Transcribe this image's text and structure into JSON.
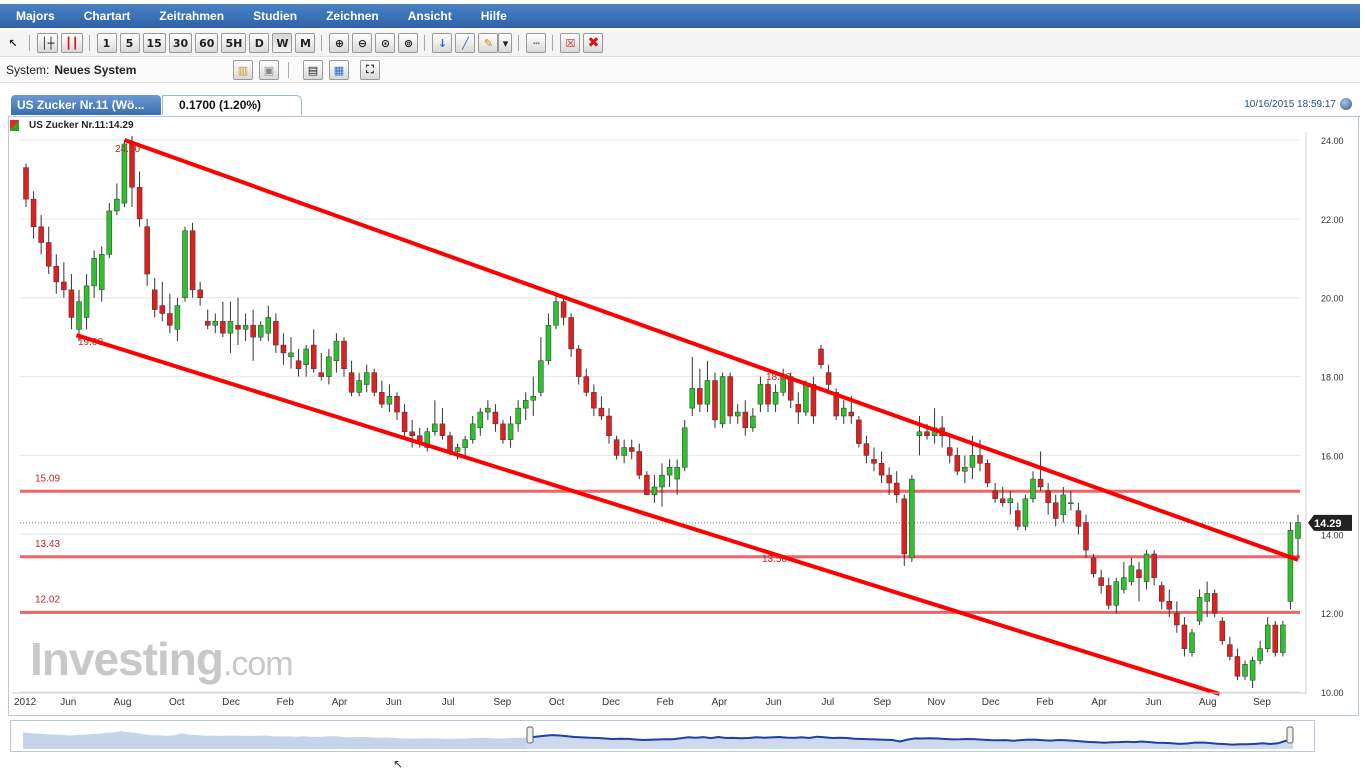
{
  "menu": [
    "Majors",
    "Chartart",
    "Zeitrahmen",
    "Studien",
    "Zeichnen",
    "Ansicht",
    "Hilfe"
  ],
  "toolbar": {
    "timeframes": [
      "1",
      "5",
      "15",
      "30",
      "60",
      "5H",
      "D",
      "W",
      "M"
    ],
    "active_timeframe": "W"
  },
  "system": {
    "label": "System:",
    "value": "Neues System"
  },
  "instrument": {
    "tab_title": "US Zucker Nr.11 (Wö...",
    "change": "0.1700 (1.20%)",
    "timestamp": "10/16/2015 18:59:17",
    "legend": "US Zucker Nr.11:14.29",
    "last_price_label": "14.29"
  },
  "watermark": {
    "brand": "Investing",
    "suffix": ".com"
  },
  "colors": {
    "up": "#2ec02e",
    "down": "#e02020",
    "line": "#ff0000",
    "accent": "#3a6eb0"
  },
  "chart_data": {
    "type": "candlestick",
    "title": "US Zucker Nr.11",
    "ylim": [
      10,
      24
    ],
    "y_ticks": [
      "24.00",
      "22.00",
      "20.00",
      "18.00",
      "16.00",
      "14.00",
      "12.00",
      "10.00"
    ],
    "x_ticks": [
      "2012",
      "Jun",
      "Aug",
      "Oct",
      "Dec",
      "Feb",
      "Apr",
      "Jun",
      "Jul",
      "Sep",
      "Oct",
      "Dec",
      "Feb",
      "Apr",
      "Jun",
      "Jul",
      "Sep",
      "Nov",
      "Dec",
      "Feb",
      "Apr",
      "Jun",
      "Aug",
      "Sep"
    ],
    "last_price": 14.29,
    "horizontal_levels": [
      {
        "value": 15.09,
        "label": "15.09"
      },
      {
        "value": 13.43,
        "label": "13.43"
      },
      {
        "value": 12.02,
        "label": "12.02"
      }
    ],
    "trend_lines": [
      {
        "name": "upper channel",
        "from": [
          0.0818,
          24.0
        ],
        "to": [
          1.0,
          13.35
        ]
      },
      {
        "name": "lower channel",
        "from": [
          0.0442,
          19.05
        ],
        "to": [
          0.9386,
          9.95
        ]
      }
    ],
    "channel_labels": [
      "24.00",
      "19.00",
      "18.00",
      "13.50"
    ],
    "candles": [
      [
        23.3,
        23.4,
        22.3,
        22.5
      ],
      [
        22.5,
        22.7,
        21.5,
        21.8
      ],
      [
        21.8,
        22.1,
        21.1,
        21.4
      ],
      [
        21.4,
        21.8,
        20.6,
        20.8
      ],
      [
        20.8,
        21.1,
        20.1,
        20.4
      ],
      [
        20.4,
        20.9,
        20.0,
        20.2
      ],
      [
        20.2,
        20.6,
        19.2,
        19.5
      ],
      [
        19.2,
        20.2,
        18.9,
        19.9
      ],
      [
        19.5,
        20.6,
        19.2,
        20.3
      ],
      [
        20.3,
        21.2,
        20.0,
        21.0
      ],
      [
        20.2,
        21.3,
        19.9,
        21.1
      ],
      [
        21.1,
        22.4,
        21.0,
        22.2
      ],
      [
        22.2,
        22.9,
        22.1,
        22.5
      ],
      [
        22.4,
        24.0,
        22.3,
        23.9
      ],
      [
        23.9,
        24.1,
        22.3,
        22.8
      ],
      [
        22.8,
        23.2,
        21.8,
        22.0
      ],
      [
        21.8,
        22.0,
        20.3,
        20.6
      ],
      [
        20.2,
        20.5,
        19.5,
        19.7
      ],
      [
        19.8,
        20.4,
        19.4,
        19.6
      ],
      [
        19.6,
        20.1,
        19.1,
        19.3
      ],
      [
        19.2,
        20.0,
        18.9,
        19.8
      ],
      [
        20.0,
        21.8,
        19.9,
        21.7
      ],
      [
        21.7,
        21.9,
        20.0,
        20.2
      ],
      [
        20.2,
        20.4,
        19.8,
        20.0
      ],
      [
        19.4,
        19.7,
        19.2,
        19.3
      ],
      [
        19.3,
        19.6,
        19.1,
        19.4
      ],
      [
        19.4,
        19.9,
        19.0,
        19.1
      ],
      [
        19.1,
        19.9,
        18.6,
        19.4
      ],
      [
        19.3,
        20.0,
        18.8,
        19.2
      ],
      [
        19.2,
        19.6,
        18.9,
        19.3
      ],
      [
        19.3,
        19.7,
        18.4,
        19.0
      ],
      [
        19.0,
        19.4,
        18.9,
        19.3
      ],
      [
        19.1,
        19.8,
        18.9,
        19.5
      ],
      [
        19.4,
        19.6,
        18.6,
        18.8
      ],
      [
        18.8,
        19.1,
        18.3,
        18.6
      ],
      [
        18.5,
        19.0,
        18.2,
        18.6
      ],
      [
        18.4,
        18.7,
        18.0,
        18.2
      ],
      [
        18.3,
        18.8,
        18.0,
        18.7
      ],
      [
        18.8,
        19.2,
        18.1,
        18.2
      ],
      [
        18.1,
        18.6,
        17.9,
        18.0
      ],
      [
        18.0,
        18.7,
        17.8,
        18.5
      ],
      [
        18.4,
        19.1,
        18.1,
        18.9
      ],
      [
        18.9,
        19.0,
        18.0,
        18.2
      ],
      [
        18.1,
        18.4,
        17.5,
        17.6
      ],
      [
        17.6,
        18.1,
        17.5,
        17.9
      ],
      [
        17.8,
        18.3,
        17.6,
        18.1
      ],
      [
        18.1,
        18.2,
        17.5,
        17.6
      ],
      [
        17.6,
        17.9,
        17.2,
        17.3
      ],
      [
        17.3,
        17.8,
        17.1,
        17.5
      ],
      [
        17.5,
        17.6,
        16.9,
        17.1
      ],
      [
        17.1,
        17.3,
        16.4,
        16.6
      ],
      [
        16.6,
        16.9,
        16.2,
        16.5
      ],
      [
        16.5,
        16.7,
        16.2,
        16.3
      ],
      [
        16.2,
        16.7,
        16.1,
        16.6
      ],
      [
        16.6,
        17.4,
        16.5,
        16.8
      ],
      [
        16.8,
        17.2,
        16.4,
        16.5
      ],
      [
        16.5,
        16.6,
        16.0,
        16.1
      ],
      [
        16.1,
        16.3,
        15.9,
        16.2
      ],
      [
        16.2,
        16.5,
        16.0,
        16.4
      ],
      [
        16.4,
        17.0,
        16.3,
        16.8
      ],
      [
        16.7,
        17.2,
        16.5,
        17.1
      ],
      [
        17.1,
        17.4,
        16.9,
        17.2
      ],
      [
        17.1,
        17.3,
        16.6,
        16.8
      ],
      [
        16.8,
        16.9,
        16.3,
        16.4
      ],
      [
        16.4,
        17.0,
        16.2,
        16.8
      ],
      [
        16.8,
        17.4,
        16.6,
        17.2
      ],
      [
        17.2,
        17.6,
        16.9,
        17.4
      ],
      [
        17.4,
        18.0,
        17.0,
        17.5
      ],
      [
        17.6,
        19.0,
        17.5,
        18.4
      ],
      [
        18.4,
        19.6,
        18.3,
        19.3
      ],
      [
        19.3,
        20.1,
        19.2,
        19.9
      ],
      [
        19.9,
        20.0,
        19.3,
        19.5
      ],
      [
        19.5,
        19.6,
        18.5,
        18.7
      ],
      [
        18.7,
        18.8,
        17.8,
        18.0
      ],
      [
        18.0,
        18.2,
        17.5,
        17.6
      ],
      [
        17.6,
        17.8,
        17.0,
        17.2
      ],
      [
        17.2,
        17.5,
        16.9,
        17.0
      ],
      [
        17.0,
        17.2,
        16.3,
        16.5
      ],
      [
        16.4,
        16.5,
        15.9,
        16.0
      ],
      [
        16.0,
        16.4,
        15.8,
        16.2
      ],
      [
        16.2,
        16.4,
        15.9,
        16.1
      ],
      [
        16.1,
        16.3,
        15.4,
        15.5
      ],
      [
        15.5,
        15.6,
        15.0,
        15.0
      ],
      [
        15.0,
        15.5,
        14.8,
        15.2
      ],
      [
        15.2,
        15.8,
        14.7,
        15.5
      ],
      [
        15.5,
        15.9,
        15.2,
        15.7
      ],
      [
        15.4,
        15.9,
        15.0,
        15.7
      ],
      [
        15.7,
        16.9,
        15.6,
        16.7
      ],
      [
        17.2,
        18.5,
        17.0,
        17.7
      ],
      [
        17.7,
        18.2,
        17.1,
        17.3
      ],
      [
        17.3,
        18.4,
        17.1,
        17.9
      ],
      [
        17.9,
        18.1,
        16.7,
        16.9
      ],
      [
        16.8,
        18.1,
        16.7,
        18.0
      ],
      [
        18.0,
        18.1,
        16.8,
        17.0
      ],
      [
        17.0,
        17.3,
        16.8,
        17.1
      ],
      [
        17.1,
        17.4,
        16.5,
        16.7
      ],
      [
        16.7,
        17.2,
        16.6,
        17.0
      ],
      [
        17.3,
        18.0,
        17.1,
        17.8
      ],
      [
        17.8,
        17.9,
        17.1,
        17.3
      ],
      [
        17.3,
        17.8,
        17.1,
        17.6
      ],
      [
        17.6,
        18.2,
        17.5,
        18.0
      ],
      [
        18.0,
        18.1,
        17.2,
        17.4
      ],
      [
        17.3,
        17.6,
        16.8,
        17.1
      ],
      [
        17.1,
        17.9,
        17.0,
        17.8
      ],
      [
        17.8,
        18.0,
        16.8,
        17.0
      ],
      [
        18.7,
        18.8,
        18.2,
        18.3
      ],
      [
        18.1,
        18.3,
        17.6,
        17.8
      ],
      [
        17.6,
        17.7,
        16.9,
        17.0
      ],
      [
        17.0,
        17.4,
        16.8,
        17.2
      ],
      [
        17.1,
        17.5,
        16.8,
        17.0
      ],
      [
        16.9,
        17.0,
        16.2,
        16.3
      ],
      [
        16.3,
        16.5,
        15.8,
        16.0
      ],
      [
        15.9,
        16.2,
        15.6,
        15.8
      ],
      [
        15.8,
        16.1,
        15.3,
        15.5
      ],
      [
        15.5,
        15.7,
        15.0,
        15.3
      ],
      [
        15.3,
        15.6,
        14.8,
        15.0
      ],
      [
        14.9,
        15.0,
        13.2,
        13.5
      ],
      [
        13.4,
        15.5,
        13.3,
        15.4
      ],
      [
        16.5,
        17.0,
        16.0,
        16.6
      ],
      [
        16.6,
        16.8,
        16.4,
        16.5
      ],
      [
        16.5,
        17.2,
        16.3,
        16.7
      ],
      [
        16.7,
        17.0,
        16.2,
        16.5
      ],
      [
        16.2,
        16.5,
        15.8,
        16.0
      ],
      [
        16.0,
        16.2,
        15.5,
        15.6
      ],
      [
        15.6,
        16.0,
        15.3,
        15.7
      ],
      [
        15.7,
        16.5,
        15.4,
        16.0
      ],
      [
        16.0,
        16.4,
        15.6,
        15.8
      ],
      [
        15.8,
        15.9,
        15.2,
        15.3
      ],
      [
        15.1,
        15.3,
        14.8,
        14.9
      ],
      [
        14.9,
        15.2,
        14.7,
        14.8
      ],
      [
        14.8,
        15.1,
        14.5,
        14.9
      ],
      [
        14.6,
        14.8,
        14.1,
        14.2
      ],
      [
        14.2,
        15.0,
        14.1,
        14.9
      ],
      [
        14.9,
        15.6,
        14.8,
        15.4
      ],
      [
        15.4,
        16.1,
        15.1,
        15.2
      ],
      [
        15.1,
        15.3,
        14.5,
        14.8
      ],
      [
        14.8,
        15.0,
        14.2,
        14.4
      ],
      [
        14.5,
        15.2,
        14.3,
        15.0
      ],
      [
        14.8,
        15.1,
        14.6,
        14.8
      ],
      [
        14.6,
        14.8,
        14.0,
        14.2
      ],
      [
        14.3,
        14.5,
        13.4,
        13.6
      ],
      [
        13.4,
        13.5,
        12.9,
        13.0
      ],
      [
        12.9,
        13.1,
        12.5,
        12.7
      ],
      [
        12.7,
        12.9,
        12.1,
        12.2
      ],
      [
        12.2,
        12.9,
        12.0,
        12.8
      ],
      [
        12.6,
        13.3,
        12.5,
        12.9
      ],
      [
        12.8,
        13.4,
        12.7,
        13.2
      ],
      [
        13.1,
        13.3,
        12.3,
        12.9
      ],
      [
        12.8,
        13.6,
        12.6,
        13.5
      ],
      [
        13.5,
        13.6,
        12.7,
        12.9
      ],
      [
        12.7,
        12.8,
        12.1,
        12.3
      ],
      [
        12.3,
        12.6,
        11.9,
        12.1
      ],
      [
        12.0,
        12.3,
        11.5,
        11.7
      ],
      [
        11.7,
        11.9,
        10.9,
        11.1
      ],
      [
        11.0,
        11.6,
        10.9,
        11.5
      ],
      [
        11.8,
        12.6,
        11.7,
        12.4
      ],
      [
        12.3,
        12.8,
        11.9,
        12.5
      ],
      [
        12.5,
        12.6,
        11.9,
        12.0
      ],
      [
        11.8,
        11.9,
        11.2,
        11.3
      ],
      [
        11.2,
        11.4,
        10.8,
        10.9
      ],
      [
        10.9,
        11.1,
        10.3,
        10.4
      ],
      [
        10.4,
        10.8,
        10.3,
        10.7
      ],
      [
        10.3,
        10.9,
        10.1,
        10.8
      ],
      [
        10.8,
        11.3,
        10.7,
        11.1
      ],
      [
        11.1,
        11.9,
        11.0,
        11.7
      ],
      [
        11.7,
        11.8,
        10.9,
        11.0
      ],
      [
        11.0,
        11.8,
        10.9,
        11.7
      ],
      [
        12.3,
        14.3,
        12.1,
        14.1
      ],
      [
        13.9,
        14.5,
        13.4,
        14.3
      ]
    ]
  }
}
